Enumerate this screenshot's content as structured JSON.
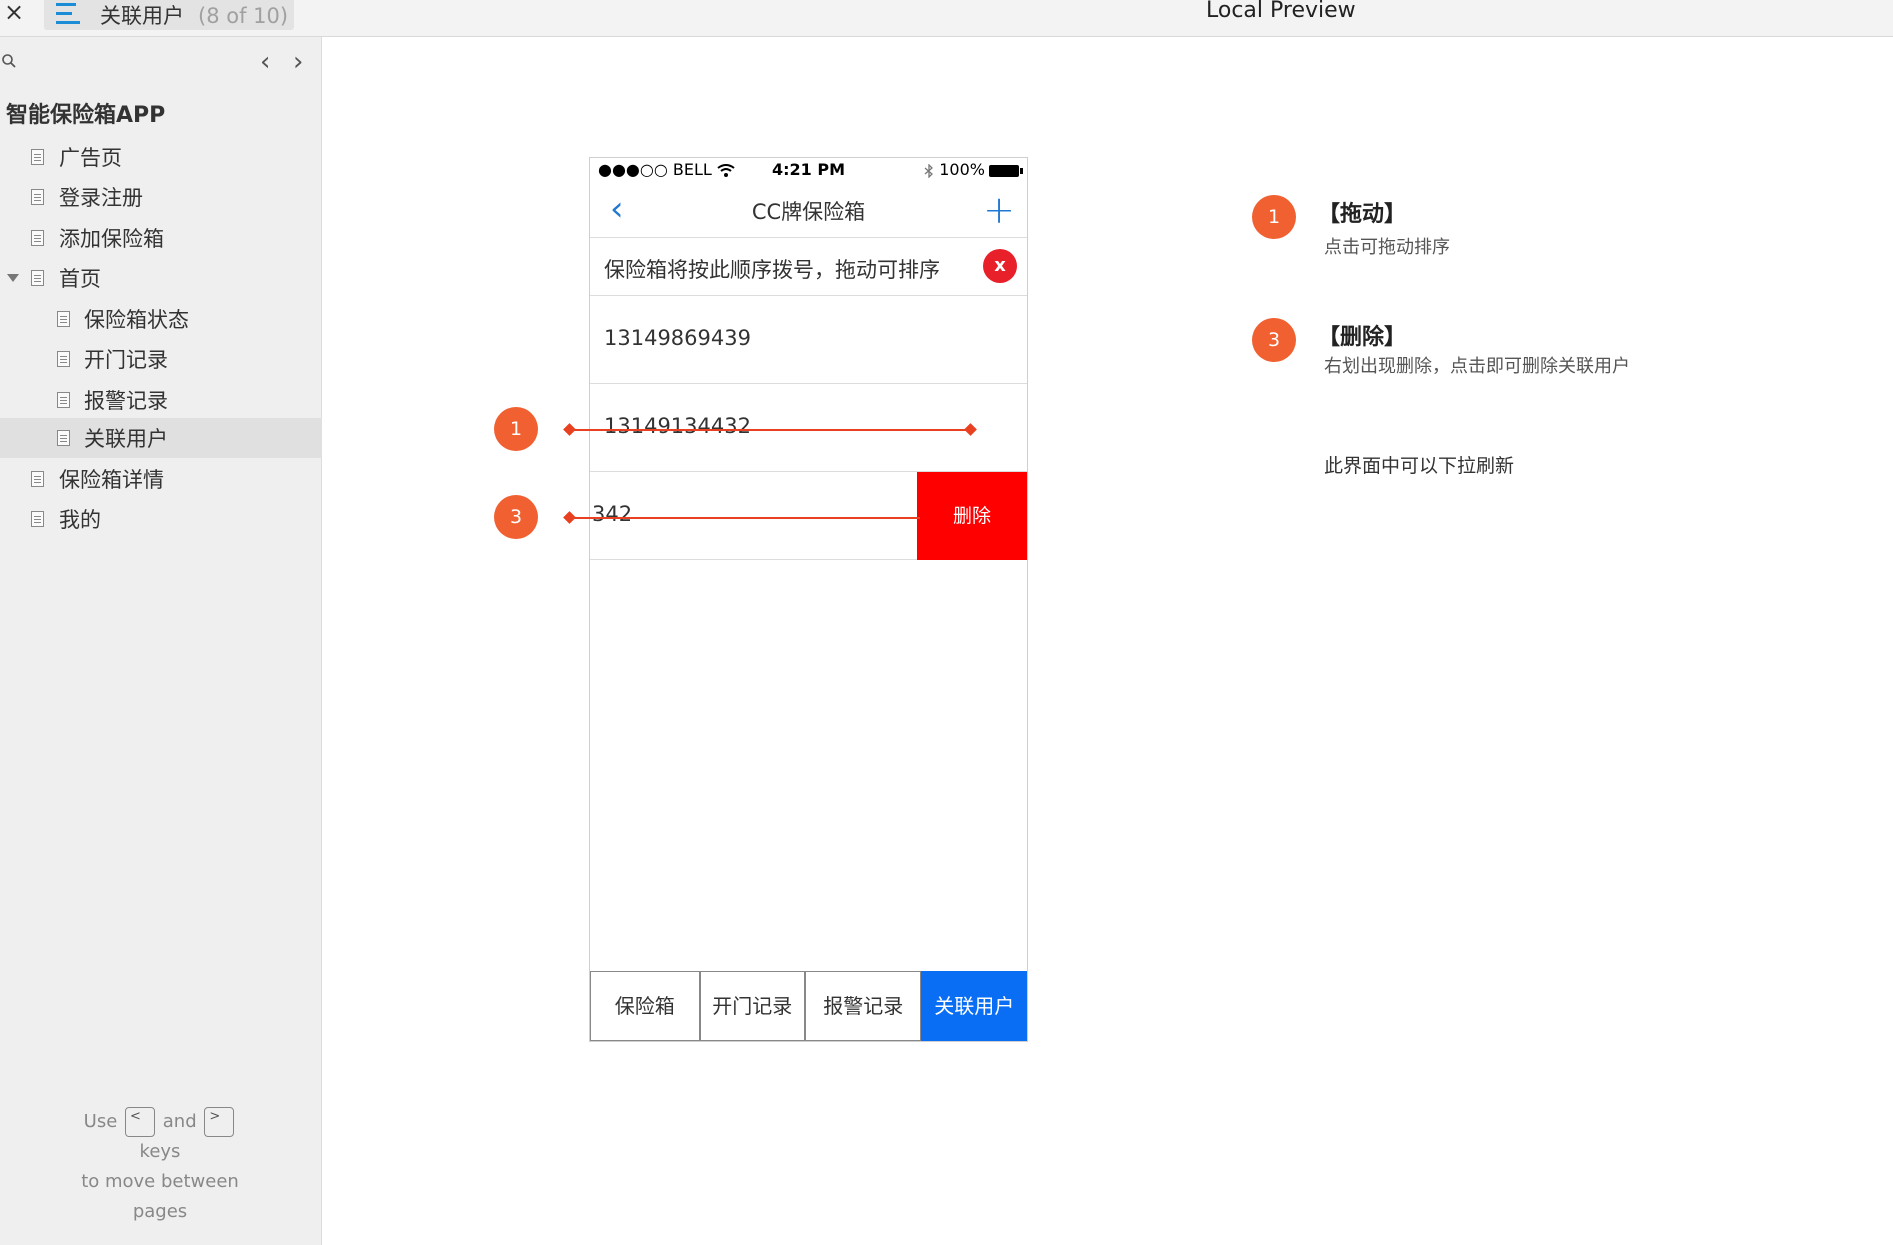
{
  "topbar": {
    "close": "×",
    "tab_title": "关联用户",
    "tab_count": "(8 of 10)",
    "preview_title": "Local Preview"
  },
  "sidebar": {
    "nav_prev": "‹",
    "nav_next": "›",
    "project": "智能保险箱APP",
    "items": [
      {
        "label": "广告页"
      },
      {
        "label": "登录注册"
      },
      {
        "label": "添加保险箱"
      },
      {
        "label": "首页"
      },
      {
        "label": "保险箱状态"
      },
      {
        "label": "开门记录"
      },
      {
        "label": "报警记录"
      },
      {
        "label": "关联用户"
      },
      {
        "label": "保险箱详情"
      },
      {
        "label": "我的"
      }
    ],
    "hint": {
      "use": "Use",
      "and": "and",
      "keys": "keys",
      "to_move": "to move between",
      "pages": "pages",
      "key_prev": "<",
      "key_next": ">"
    }
  },
  "phone": {
    "status": {
      "carrier": "●●●○○ BELL",
      "time": "4:21 PM",
      "battery": "100%"
    },
    "nav": {
      "back": "‹",
      "title": "CC牌保险箱",
      "add": "+"
    },
    "tip": {
      "text": "保险箱将按此顺序拨号，拖动可排序",
      "close": "x"
    },
    "users": [
      {
        "phone": "13149869439"
      },
      {
        "phone": "13149134432"
      },
      {
        "phone": "342"
      }
    ],
    "delete_label": "删除",
    "tabs": [
      {
        "label": "保险箱"
      },
      {
        "label": "开门记录"
      },
      {
        "label": "报警记录"
      },
      {
        "label": "关联用户"
      }
    ]
  },
  "annotations": {
    "marker_1": "1",
    "marker_3": "3",
    "notes": [
      {
        "num": "1",
        "title": "【拖动】",
        "desc": "点击可拖动排序"
      },
      {
        "num": "3",
        "title": "【删除】",
        "desc": "右划出现删除，点击即可删除关联用户"
      }
    ],
    "refresh_note": "此界面中可以下拉刷新"
  },
  "colors": {
    "accent_blue": "#1f78d1",
    "tab_active": "#0a6ef5",
    "delete_red": "#ff0000",
    "marker_orange": "#f06030"
  }
}
